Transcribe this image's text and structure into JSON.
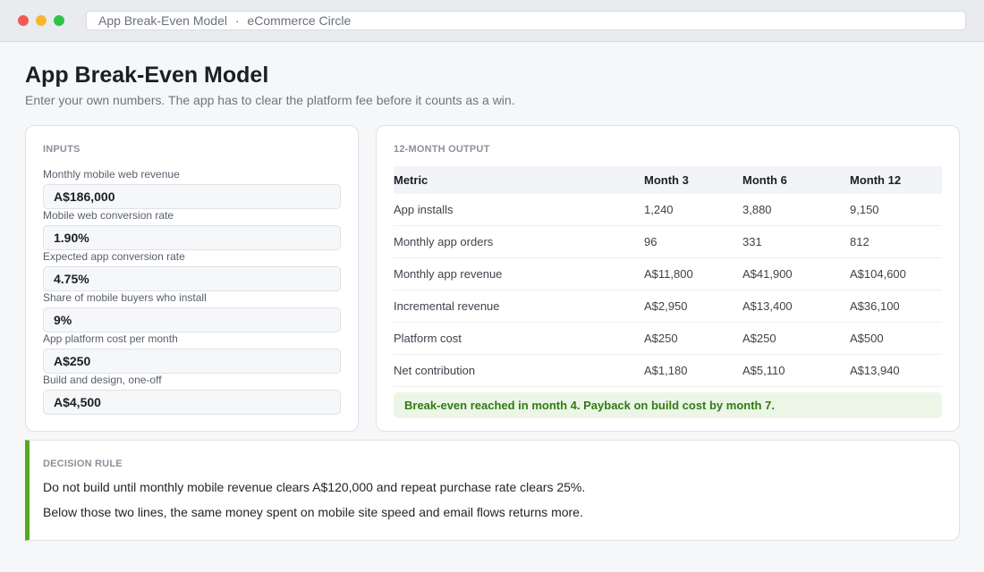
{
  "window": {
    "tab_title": "App Break-Even Model",
    "separator": "·",
    "site_name": "eCommerce Circle"
  },
  "header": {
    "title": "App Break-Even Model",
    "subtitle": "Enter your own numbers. The app has to clear the platform fee before it counts as a win."
  },
  "inputs": {
    "section_label": "INPUTS",
    "fields": [
      {
        "label": "Monthly mobile web revenue",
        "value": "A$186,000"
      },
      {
        "label": "Mobile web conversion rate",
        "value": "1.90%"
      },
      {
        "label": "Expected app conversion rate",
        "value": "4.75%"
      },
      {
        "label": "Share of mobile buyers who install",
        "value": "9%"
      },
      {
        "label": "App platform cost per month",
        "value": "A$250"
      },
      {
        "label": "Build and design, one-off",
        "value": "A$4,500"
      }
    ]
  },
  "output": {
    "section_label": "12-MONTH OUTPUT",
    "columns": [
      "Metric",
      "Month 3",
      "Month 6",
      "Month 12"
    ],
    "rows": [
      [
        "App installs",
        "1,240",
        "3,880",
        "9,150"
      ],
      [
        "Monthly app orders",
        "96",
        "331",
        "812"
      ],
      [
        "Monthly app revenue",
        "A$11,800",
        "A$41,900",
        "A$104,600"
      ],
      [
        "Incremental revenue",
        "A$2,950",
        "A$13,400",
        "A$36,100"
      ],
      [
        "Platform cost",
        "A$250",
        "A$250",
        "A$500"
      ],
      [
        "Net contribution",
        "A$1,180",
        "A$5,110",
        "A$13,940"
      ]
    ],
    "banner": "Break-even reached in month 4. Payback on build cost by month 7."
  },
  "decision": {
    "section_label": "DECISION RULE",
    "line_1": "Do not build until monthly mobile revenue clears A$120,000 and repeat purchase rate clears 25%.",
    "line_2": "Below those two lines, the same money spent on mobile site speed and email flows returns more."
  },
  "colors": {
    "accent_green": "#56a81f",
    "banner_text": "#2f7a16",
    "banner_bg": "#ecf6e6",
    "dot_red": "#f25a52",
    "dot_yellow": "#f5b730",
    "dot_green": "#30c147"
  }
}
